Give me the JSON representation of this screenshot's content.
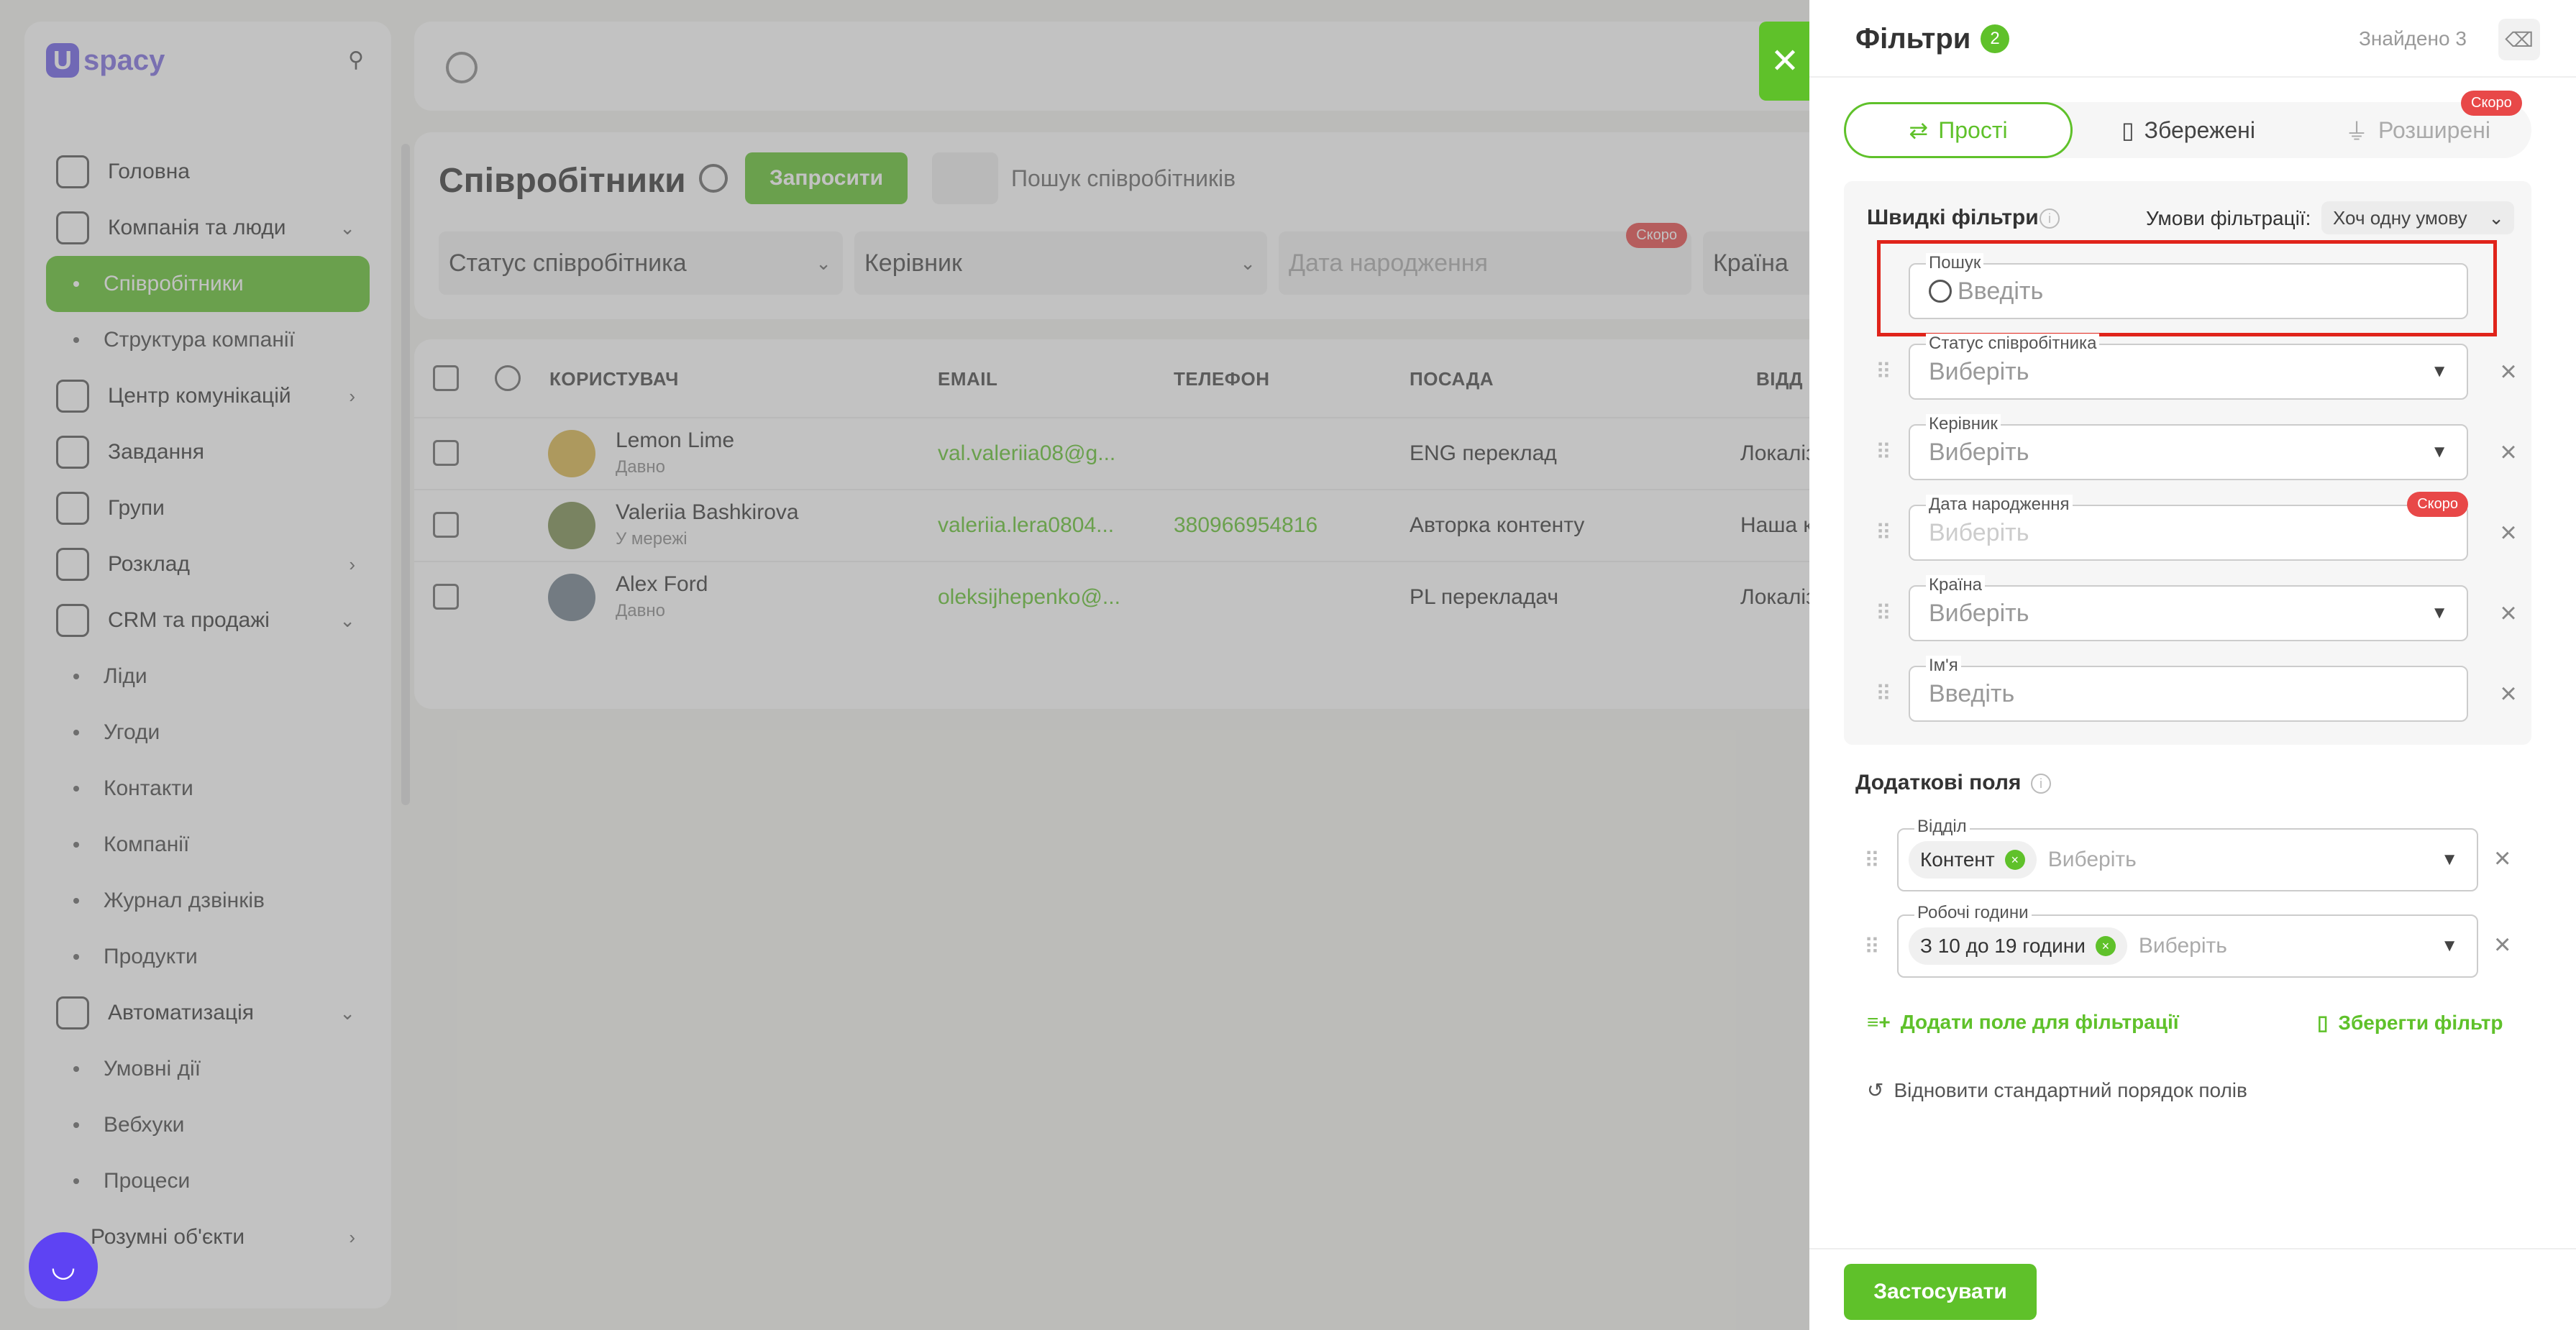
{
  "app": {
    "logo_text": "spacy",
    "logo_mark": "U"
  },
  "sidebar": {
    "items": [
      {
        "label": "Головна",
        "icon": "home-icon"
      },
      {
        "label": "Компанія та люди",
        "icon": "company-icon",
        "expanded": true
      },
      {
        "label": "Співробітники",
        "sub": true,
        "active": true
      },
      {
        "label": "Структура компанії",
        "sub": true
      },
      {
        "label": "Центр комунікацій",
        "icon": "chat-icon"
      },
      {
        "label": "Завдання",
        "icon": "check-icon"
      },
      {
        "label": "Групи",
        "icon": "users-icon"
      },
      {
        "label": "Розклад",
        "icon": "calendar-icon"
      },
      {
        "label": "CRM та продажі",
        "icon": "database-icon",
        "expanded": true
      },
      {
        "label": "Ліди",
        "sub": true
      },
      {
        "label": "Угоди",
        "sub": true
      },
      {
        "label": "Контакти",
        "sub": true
      },
      {
        "label": "Компанії",
        "sub": true
      },
      {
        "label": "Журнал дзвінків",
        "sub": true
      },
      {
        "label": "Продукти",
        "sub": true
      },
      {
        "label": "Автоматизація",
        "icon": "lightning-icon",
        "expanded": true
      },
      {
        "label": "Умовні дії",
        "sub": true
      },
      {
        "label": "Вебхуки",
        "sub": true
      },
      {
        "label": "Процеси",
        "sub": true
      },
      {
        "label": "Розумні об'єкти",
        "sub": true
      }
    ]
  },
  "page": {
    "title": "Співробітники",
    "invite_label": "Запросити",
    "search_placeholder": "Пошук співробітників",
    "filters": [
      "Статус співробітника",
      "Керівник",
      "Дата народження",
      "Країна"
    ],
    "soon_label": "Скоро"
  },
  "table": {
    "headers": [
      "КОРИСТУВАЧ",
      "EMAIL",
      "ТЕЛЕФОН",
      "ПОСАДА",
      "ВІДД"
    ],
    "rows": [
      {
        "name": "Lemon Lime",
        "status": "Давно",
        "email": "val.valeriia08@g...",
        "phone": "",
        "position": "ENG переклад",
        "dept": "Локаліз"
      },
      {
        "name": "Valeriia Bashkirova",
        "status": "У мережі",
        "email": "valeriia.lera0804...",
        "phone": "380966954816",
        "position": "Авторка контенту",
        "dept": "Наша к"
      },
      {
        "name": "Alex Ford",
        "status": "Давно",
        "email": "oleksijhepenko@...",
        "phone": "",
        "position": "PL перекладач",
        "dept": "Локаліз"
      }
    ]
  },
  "drawer": {
    "title": "Фільтри",
    "count": "2",
    "found": "Знайдено 3",
    "tabs": {
      "simple": "Прості",
      "saved": "Збережені",
      "advanced": "Розширені"
    },
    "soon": "Скоро",
    "quick_title": "Швидкі фільтри",
    "cond_label": "Умови фільтрації:",
    "cond_value": "Хоч одну умову",
    "fields": {
      "search": {
        "label": "Пошук",
        "placeholder": "Введіть"
      },
      "status": {
        "label": "Статус співробітника",
        "placeholder": "Виберіть"
      },
      "manager": {
        "label": "Керівник",
        "placeholder": "Виберіть"
      },
      "birth": {
        "label": "Дата народження",
        "placeholder": "Виберіть"
      },
      "country": {
        "label": "Країна",
        "placeholder": "Виберіть"
      },
      "name": {
        "label": "Ім'я",
        "placeholder": "Введіть"
      }
    },
    "extra_title": "Додаткові поля",
    "extra": {
      "dept": {
        "label": "Відділ",
        "chip": "Контент",
        "placeholder": "Виберіть"
      },
      "hours": {
        "label": "Робочі години",
        "chip": "З 10 до 19 години",
        "placeholder": "Виберіть"
      }
    },
    "add_field": "Додати поле для фільтрації",
    "save_filter": "Зберегти фільтр",
    "reset_order": "Відновити стандартний порядок полів",
    "apply": "Застосувати"
  },
  "colors": {
    "accent": "#5fc12a",
    "danger": "#e84848",
    "highlight": "#e0241b"
  }
}
